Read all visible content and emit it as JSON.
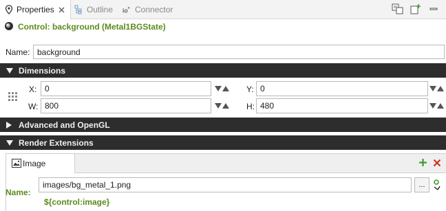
{
  "tabs": [
    {
      "label": "Properties",
      "active": true,
      "icon": "properties-icon"
    },
    {
      "label": "Outline",
      "active": false,
      "icon": "outline-icon"
    },
    {
      "label": "Connector",
      "active": false,
      "icon": "connector-icon"
    }
  ],
  "control": {
    "title": "Control: background (Metal1BGState)"
  },
  "name": {
    "label": "Name:",
    "value": "background"
  },
  "sections": {
    "dimensions": "Dimensions",
    "advanced": "Advanced and OpenGL",
    "render": "Render Extensions"
  },
  "dimensions": {
    "x_label": "X:",
    "x_value": "0",
    "y_label": "Y:",
    "y_value": "0",
    "w_label": "W:",
    "w_value": "800",
    "h_label": "H:",
    "h_value": "480"
  },
  "render_ext": {
    "tab_label": "Image",
    "name_label": "Name:",
    "path": "images/bg_metal_1.png",
    "browse_label": "...",
    "expression": "${control:image}"
  },
  "colors": {
    "accent_green": "#5c8a1e",
    "section_bg": "#2d2d2d",
    "remove_red": "#d52b1e",
    "add_green": "#3d9a2e"
  }
}
